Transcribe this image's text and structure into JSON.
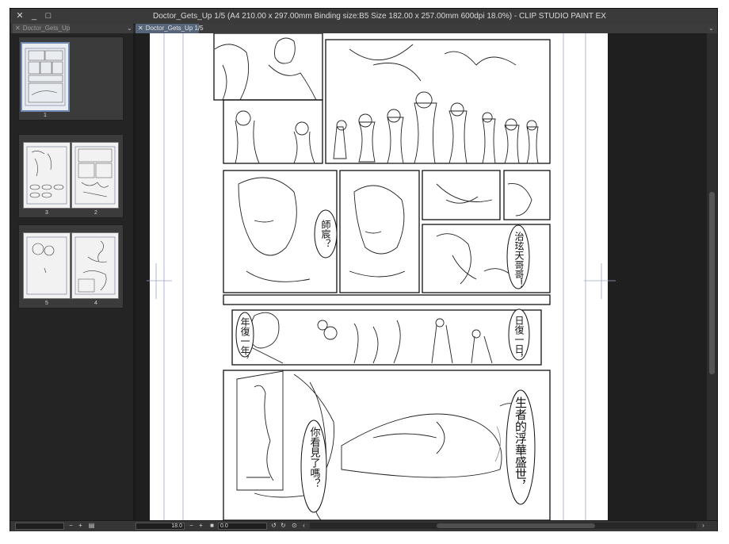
{
  "window": {
    "title": "Doctor_Gets_Up 1/5 (A4 210.00 x 297.00mm Binding size:B5 Size 182.00 x 257.00mm 600dpi 18.0%)  - CLIP STUDIO PAINT EX",
    "controls": {
      "close": "✕",
      "minimize": "_",
      "maximize": "□"
    }
  },
  "tabs": {
    "left": {
      "label": "Doctor_Gets_Up",
      "close": "✕"
    },
    "main": {
      "label": "Doctor_Gets_Up 1/5",
      "close": "✕"
    },
    "chevron": "⌄"
  },
  "page_manager": {
    "pages": [
      {
        "number": "1"
      },
      {
        "number": "3"
      },
      {
        "number": "2"
      },
      {
        "number": "5"
      },
      {
        "number": "4"
      }
    ]
  },
  "canvas": {
    "speech": [
      {
        "id": "b1",
        "text": "師宸？"
      },
      {
        "id": "b2",
        "text": "治玹天哥哥！"
      },
      {
        "id": "b3",
        "text": "日復一日，"
      },
      {
        "id": "b4",
        "text": "年復一年，"
      },
      {
        "id": "b5",
        "text": "生者的浮華盛世，"
      },
      {
        "id": "b6",
        "text": "你看見了嗎？"
      }
    ]
  },
  "statusbar": {
    "zoom_value": "18.0",
    "angle_value": "0.0",
    "minus": "−",
    "plus": "+"
  }
}
